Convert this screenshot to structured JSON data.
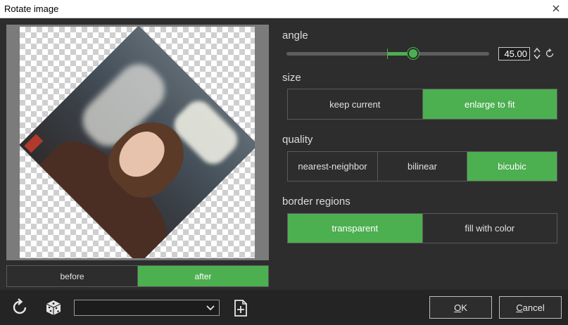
{
  "window": {
    "title": "Rotate image",
    "close_icon": "close-icon"
  },
  "preview": {
    "toggle": [
      {
        "label": "before",
        "active": false
      },
      {
        "label": "after",
        "active": true
      }
    ]
  },
  "angle": {
    "label": "angle",
    "value": "45.00",
    "slider_min": -180,
    "slider_max": 180,
    "slider_value": 45
  },
  "size": {
    "label": "size",
    "options": [
      {
        "label": "keep current",
        "active": false
      },
      {
        "label": "enlarge to fit",
        "active": true
      }
    ]
  },
  "quality": {
    "label": "quality",
    "options": [
      {
        "label": "nearest-neighbor",
        "active": false
      },
      {
        "label": "bilinear",
        "active": false
      },
      {
        "label": "bicubic",
        "active": true
      }
    ]
  },
  "border": {
    "label": "border regions",
    "options": [
      {
        "label": "transparent",
        "active": true
      },
      {
        "label": "fill with color",
        "active": false
      }
    ]
  },
  "toolbar": {
    "reset_icon": "reset-icon",
    "random_icon": "dice-icon",
    "preset_value": "",
    "add_preset_icon": "add-preset-icon"
  },
  "buttons": {
    "ok_accel": "O",
    "ok_rest": "K",
    "cancel_accel": "C",
    "cancel_rest": "ancel"
  },
  "colors": {
    "accent": "#4caf50",
    "background": "#2d2d2d",
    "border": "#5a5a5a"
  }
}
